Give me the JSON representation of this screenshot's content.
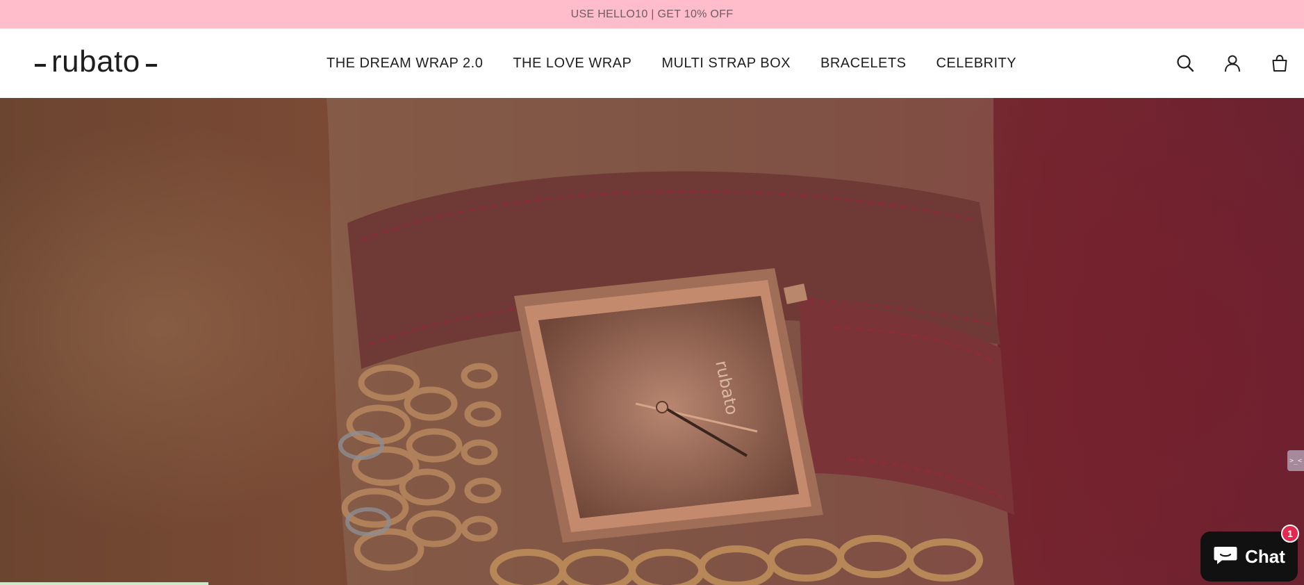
{
  "announcement": {
    "text": "USE HELLO10 | GET 10% OFF"
  },
  "header": {
    "logo_text": "rubato",
    "nav": [
      {
        "label": "THE DREAM WRAP 2.0"
      },
      {
        "label": "THE LOVE WRAP"
      },
      {
        "label": "MULTI STRAP BOX"
      },
      {
        "label": "BRACELETS"
      },
      {
        "label": "CELEBRITY"
      }
    ],
    "icons": [
      "search-icon",
      "account-icon",
      "cart-icon"
    ]
  },
  "hero": {
    "image_description_icon": "watch-hero-image",
    "watch_dial_text": "rubato"
  },
  "side_tab": {
    "text": ">_<"
  },
  "chat": {
    "label": "Chat",
    "badge_count": "1"
  },
  "colors": {
    "announcement_bg": "#ffbccb",
    "header_bg": "#ffffff",
    "text_dark": "#1e1e1e",
    "chat_bg": "#111111",
    "badge_red": "#e5284f"
  }
}
